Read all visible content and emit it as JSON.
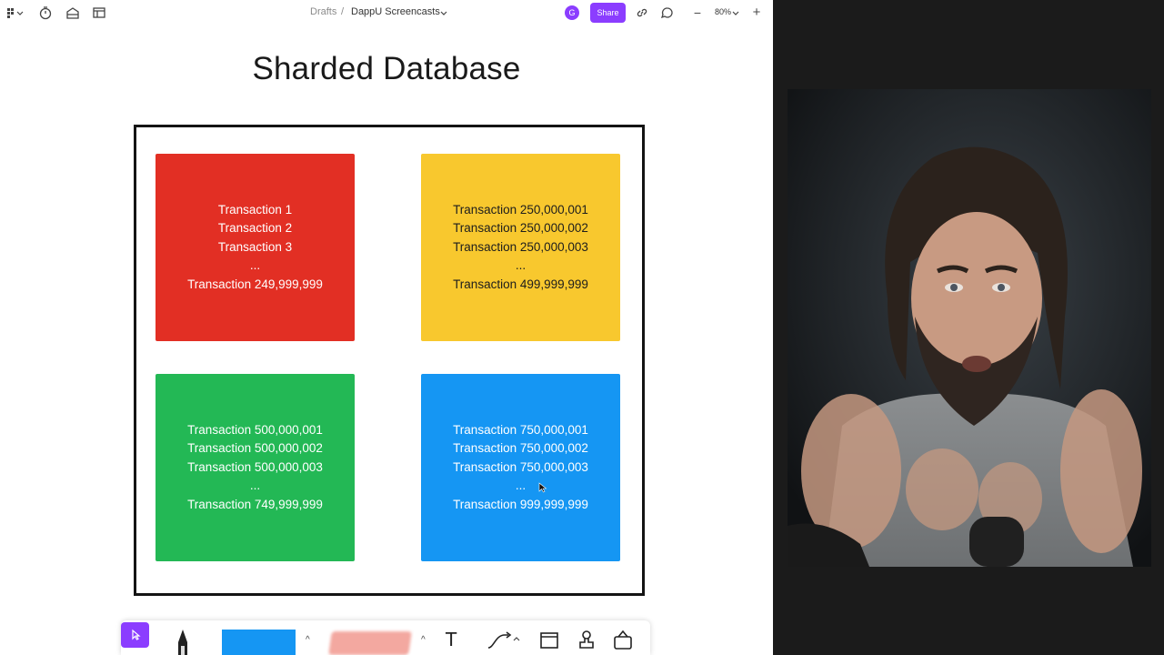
{
  "app": {
    "breadcrumb": {
      "root": "Drafts",
      "separator": "/",
      "current": "DappU Screencasts"
    },
    "avatar_initial": "G",
    "share_label": "Share",
    "zoom": "80%",
    "zoom_out_label": "−",
    "zoom_in_label": "+"
  },
  "canvas": {
    "title": "Sharded Database",
    "shards": [
      {
        "color": "#e22f24",
        "lines": [
          "Transaction 1",
          "Transaction 2",
          "Transaction 3",
          "...",
          "Transaction 249,999,999"
        ]
      },
      {
        "color": "#f8c82e",
        "lines": [
          "Transaction 250,000,001",
          "Transaction 250,000,002",
          "Transaction 250,000,003",
          "...",
          "Transaction 499,999,999"
        ]
      },
      {
        "color": "#23b855",
        "lines": [
          "Transaction 500,000,001",
          "Transaction 500,000,002",
          "Transaction 500,000,003",
          "...",
          "Transaction 749,999,999"
        ]
      },
      {
        "color": "#1596f3",
        "lines": [
          "Transaction 750,000,001",
          "Transaction 750,000,002",
          "Transaction 750,000,003",
          "...",
          "Transaction 999,999,999"
        ]
      }
    ]
  },
  "toolbar": {
    "icons": [
      "select-icon",
      "pen-icon",
      "shape-color-swatch",
      "sticky-note-swatch",
      "text-icon",
      "connector-icon",
      "frame-icon",
      "stamp-icon",
      "widget-icon"
    ],
    "accent": "#8b3dff",
    "text_tool_label": "T"
  },
  "colors": {
    "accent": "#8b3dff",
    "video_background": "#1b1b1b"
  }
}
